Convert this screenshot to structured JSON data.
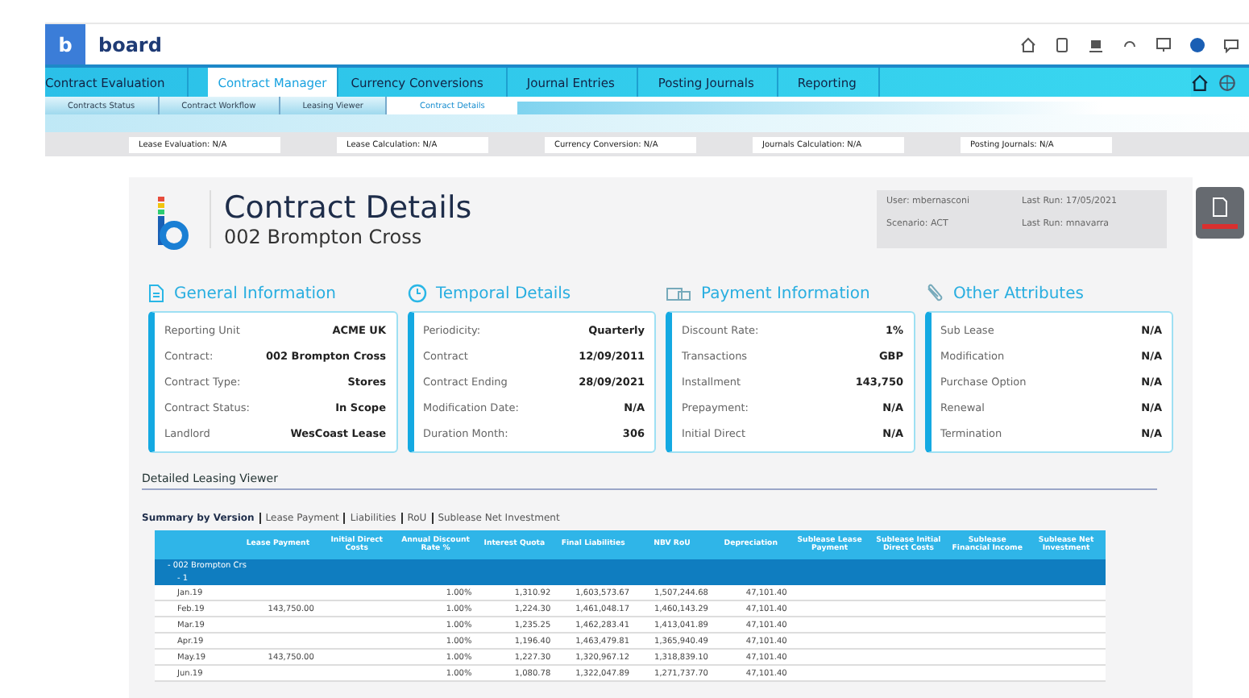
{
  "app": {
    "logo_letter": "b",
    "brand": "board"
  },
  "main_tabs": [
    {
      "label": "Contract Evaluation",
      "selected": false
    },
    {
      "label": "Contract Manager",
      "selected": true
    },
    {
      "label": "Currency Conversions",
      "selected": false
    },
    {
      "label": "Journal Entries",
      "selected": false
    },
    {
      "label": "Posting Journals",
      "selected": false
    },
    {
      "label": "Reporting",
      "selected": false
    }
  ],
  "sub_tabs": [
    {
      "label": "Contracts Status",
      "selected": false
    },
    {
      "label": "Contract Workflow",
      "selected": false
    },
    {
      "label": "Leasing Viewer",
      "selected": false
    },
    {
      "label": "Contract Details",
      "selected": true
    }
  ],
  "status_fields": [
    "Lease Evaluation: N/A",
    "Lease Calculation: N/A",
    "Currency Conversion: N/A",
    "Journals Calculation: N/A",
    "Posting Journals: N/A"
  ],
  "header": {
    "title": "Contract Details",
    "subtitle": "002 Brompton Cross",
    "info": [
      "User: mbernasconi",
      "Last Run: 17/05/2021",
      "Scenario: ACT",
      "Last Run: mnavarra"
    ]
  },
  "cards": [
    {
      "kind": "document",
      "title": "General Information",
      "rows": [
        {
          "label": "Reporting Unit",
          "value": "ACME UK"
        },
        {
          "label": "Contract:",
          "value": "002 Brompton Cross"
        },
        {
          "label": "Contract Type:",
          "value": "Stores"
        },
        {
          "label": "Contract Status:",
          "value": "In Scope"
        },
        {
          "label": "Landlord",
          "value": "WesCoast Lease"
        }
      ]
    },
    {
      "kind": "clock",
      "title": "Temporal Details",
      "rows": [
        {
          "label": "Periodicity:",
          "value": "Quarterly"
        },
        {
          "label": "Contract",
          "value": "12/09/2011"
        },
        {
          "label": "Contract Ending",
          "value": "28/09/2021"
        },
        {
          "label": "Modification Date:",
          "value": "N/A"
        },
        {
          "label": "Duration Month:",
          "value": "306"
        }
      ]
    },
    {
      "kind": "money",
      "title": "Payment Information",
      "rows": [
        {
          "label": "Discount Rate:",
          "value": "1%"
        },
        {
          "label": "Transactions",
          "value": "GBP"
        },
        {
          "label": "Installment",
          "value": "143,750"
        },
        {
          "label": "Prepayment:",
          "value": "N/A"
        },
        {
          "label": "Initial Direct",
          "value": "N/A"
        }
      ]
    },
    {
      "kind": "clip",
      "title": "Other Attributes",
      "rows": [
        {
          "label": "Sub Lease",
          "value": "N/A"
        },
        {
          "label": "Modification",
          "value": "N/A"
        },
        {
          "label": "Purchase Option",
          "value": "N/A"
        },
        {
          "label": "Renewal",
          "value": "N/A"
        },
        {
          "label": "Termination",
          "value": "N/A"
        }
      ]
    }
  ],
  "viewer": {
    "title": "Detailed Leasing Viewer",
    "links": [
      {
        "label": "Summary by Version",
        "selected": true
      },
      {
        "label": "Lease Payment",
        "selected": false
      },
      {
        "label": "Liabilities",
        "selected": false
      },
      {
        "label": "RoU",
        "selected": false
      },
      {
        "label": "Sublease Net Investment",
        "selected": false
      }
    ],
    "columns": [
      "Lease Payment",
      "Initial Direct Costs",
      "Annual Discount Rate %",
      "Interest Quota",
      "Final Liabilities",
      "NBV RoU",
      "Depreciation",
      "Sublease Lease Payment",
      "Sublease Initial Direct Costs",
      "Sublease Financial Income",
      "Sublease Net Investment"
    ],
    "groups": [
      "- 002 Brompton Crs",
      "- 1"
    ],
    "rows": [
      {
        "period": "Jan.19",
        "cells": [
          "",
          "",
          "1.00%",
          "1,310.92",
          "1,603,573.67",
          "1,507,244.68",
          "47,101.40"
        ]
      },
      {
        "period": "Feb.19",
        "cells": [
          "143,750.00",
          "",
          "1.00%",
          "1,224.30",
          "1,461,048.17",
          "1,460,143.29",
          "47,101.40"
        ]
      },
      {
        "period": "Mar.19",
        "cells": [
          "",
          "",
          "1.00%",
          "1,235.25",
          "1,462,283.41",
          "1,413,041.89",
          "47,101.40"
        ]
      },
      {
        "period": "Apr.19",
        "cells": [
          "",
          "",
          "1.00%",
          "1,196.40",
          "1,463,479.81",
          "1,365,940.49",
          "47,101.40"
        ]
      },
      {
        "period": "May.19",
        "cells": [
          "143,750.00",
          "",
          "1.00%",
          "1,227.30",
          "1,320,967.12",
          "1,318,839.10",
          "47,101.40"
        ]
      },
      {
        "period": "Jun.19",
        "cells": [
          "",
          "",
          "1.00%",
          "1,080.78",
          "1,322,047.89",
          "1,271,737.70",
          "47,101.40"
        ]
      }
    ]
  }
}
